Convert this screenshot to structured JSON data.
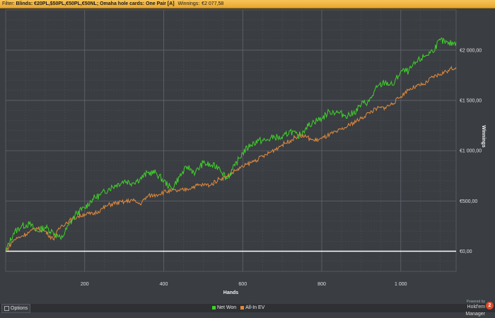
{
  "filter_bar": {
    "label": "Filter:",
    "text": "Blinds: €20PL,$50PL,€50PL,€50NL; Omaha hole cards: One Pair [A]",
    "winnings_label": "Winnings:",
    "winnings_value": "€2 077,58"
  },
  "bottom": {
    "options_label": "Options",
    "brand_powered": "Powered by",
    "brand_name": "Hold'em Manager",
    "brand_logo": "2"
  },
  "colors": {
    "net_won": "#3fd12a",
    "all_in_ev": "#e08a3c",
    "zero_line": "#ffffff",
    "grid": "#50545a",
    "background": "#3a3d42"
  },
  "chart_data": {
    "type": "line",
    "xlabel": "Hands",
    "ylabel": "Winnings",
    "x_ticks": [
      200,
      400,
      600,
      800,
      1000
    ],
    "x_tick_labels": [
      "200",
      "400",
      "600",
      "800",
      "1 000"
    ],
    "y_ticks": [
      0,
      500,
      1000,
      1500,
      2000
    ],
    "y_tick_labels": [
      "€0,00",
      "€500,00",
      "€1 000,00",
      "€1 500,00",
      "€2 000,00"
    ],
    "xlim": [
      0,
      1140
    ],
    "ylim": [
      -200,
      2400
    ],
    "x": [
      0,
      20,
      40,
      60,
      80,
      100,
      120,
      140,
      160,
      180,
      200,
      220,
      240,
      260,
      280,
      300,
      320,
      340,
      360,
      380,
      400,
      420,
      440,
      460,
      480,
      500,
      520,
      540,
      560,
      580,
      600,
      620,
      640,
      660,
      680,
      700,
      720,
      740,
      760,
      780,
      800,
      820,
      840,
      860,
      880,
      900,
      920,
      940,
      960,
      980,
      1000,
      1020,
      1040,
      1060,
      1080,
      1100,
      1120,
      1140
    ],
    "series": [
      {
        "name": "Net Won",
        "values": [
          0,
          180,
          250,
          270,
          200,
          240,
          190,
          120,
          260,
          380,
          430,
          520,
          560,
          620,
          660,
          700,
          680,
          720,
          780,
          780,
          700,
          620,
          740,
          840,
          780,
          880,
          850,
          840,
          720,
          850,
          980,
          1060,
          1100,
          1100,
          1140,
          1120,
          1200,
          1140,
          1230,
          1290,
          1320,
          1390,
          1380,
          1350,
          1370,
          1460,
          1490,
          1630,
          1680,
          1650,
          1790,
          1790,
          1880,
          1940,
          1990,
          2100,
          2060,
          2077
        ]
      },
      {
        "name": "All-In EV",
        "values": [
          0,
          110,
          150,
          190,
          230,
          200,
          120,
          250,
          300,
          340,
          370,
          370,
          410,
          460,
          480,
          490,
          510,
          470,
          550,
          560,
          590,
          600,
          600,
          620,
          650,
          660,
          660,
          720,
          740,
          800,
          840,
          880,
          920,
          960,
          1010,
          1060,
          1100,
          1150,
          1140,
          1100,
          1120,
          1160,
          1190,
          1230,
          1280,
          1320,
          1380,
          1420,
          1430,
          1470,
          1540,
          1610,
          1640,
          1660,
          1730,
          1760,
          1800,
          1830
        ]
      }
    ],
    "grid": true,
    "legend_position": "bottom-center"
  }
}
